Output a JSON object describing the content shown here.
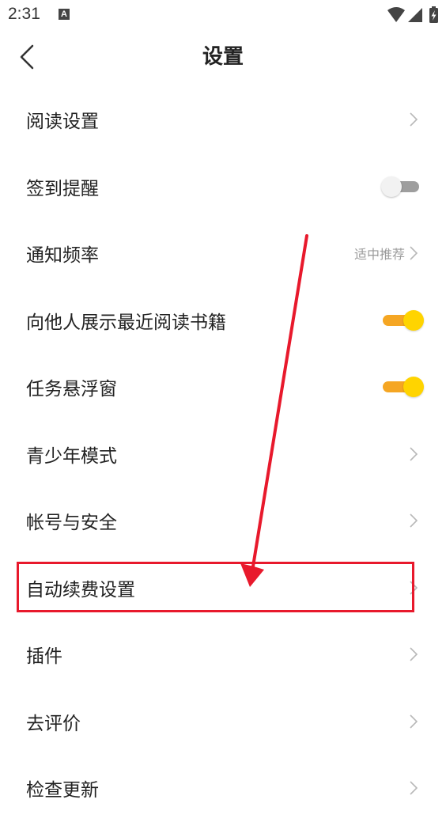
{
  "status_bar": {
    "time": "2:31",
    "a_icon": "A",
    "icons": [
      "wifi-icon",
      "signal-icon",
      "battery-charging-icon"
    ]
  },
  "nav": {
    "title": "设置",
    "back_icon": "chevron-left-icon"
  },
  "settings": [
    {
      "label": "阅读设置",
      "control": "chevron"
    },
    {
      "label": "签到提醒",
      "control": "toggle",
      "on": false
    },
    {
      "label": "通知频率",
      "control": "chevron",
      "value": "适中推荐"
    },
    {
      "label": "向他人展示最近阅读书籍",
      "control": "toggle",
      "on": true
    },
    {
      "label": "任务悬浮窗",
      "control": "toggle",
      "on": true
    },
    {
      "label": "青少年模式",
      "control": "chevron"
    },
    {
      "label": "帐号与安全",
      "control": "chevron"
    },
    {
      "label": "自动续费设置",
      "control": "chevron"
    },
    {
      "label": "插件",
      "control": "chevron"
    },
    {
      "label": "去评价",
      "control": "chevron"
    },
    {
      "label": "检查更新",
      "control": "chevron"
    }
  ],
  "colors": {
    "toggle_on_track": "#f5a623",
    "toggle_on_knob": "#ffd400",
    "toggle_off_track": "#9e9e9e",
    "annotation": "#e8192c",
    "secondary_text": "#9b9b9b"
  }
}
